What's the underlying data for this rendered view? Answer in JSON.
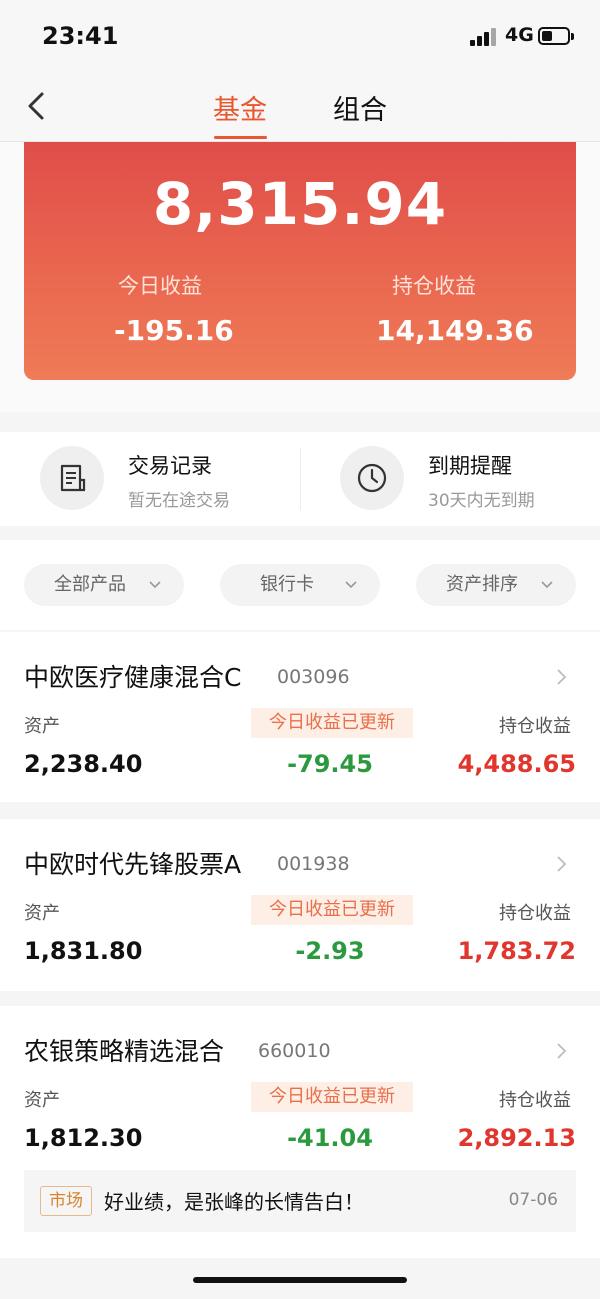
{
  "status": {
    "time": "23:41",
    "network": "4G"
  },
  "nav": {
    "tabs": [
      "基金",
      "组合"
    ]
  },
  "summary": {
    "total": "8,315.94",
    "today_label": "今日收益",
    "today_value": "-195.16",
    "holding_label": "持仓收益",
    "holding_value": "14,149.36"
  },
  "quick_actions": [
    {
      "title": "交易记录",
      "subtitle": "暂无在途交易",
      "icon": "receipt-icon"
    },
    {
      "title": "到期提醒",
      "subtitle": "30天内无到期",
      "icon": "clock-icon"
    }
  ],
  "filters": [
    "全部产品",
    "银行卡",
    "资产排序"
  ],
  "funds": [
    {
      "name": "中欧医疗健康混合C",
      "code": "003096",
      "asset_label": "资产",
      "asset": "2,238.40",
      "today_badge": "今日收益已更新",
      "today": "-79.45",
      "holding_label": "持仓收益",
      "holding": "4,488.65"
    },
    {
      "name": "中欧时代先锋股票A",
      "code": "001938",
      "asset_label": "资产",
      "asset": "1,831.80",
      "today_badge": "今日收益已更新",
      "today": "-2.93",
      "holding_label": "持仓收益",
      "holding": "1,783.72"
    },
    {
      "name": "农银策略精选混合",
      "code": "660010",
      "asset_label": "资产",
      "asset": "1,812.30",
      "today_badge": "今日收益已更新",
      "today": "-41.04",
      "holding_label": "持仓收益",
      "holding": "2,892.13"
    }
  ],
  "news": {
    "tag": "市场",
    "text": "好业绩，是张峰的长情告白！",
    "date": "07-06"
  },
  "colors": {
    "accent": "#e8572f",
    "gain": "#e0362e",
    "loss": "#2b9a3f"
  }
}
